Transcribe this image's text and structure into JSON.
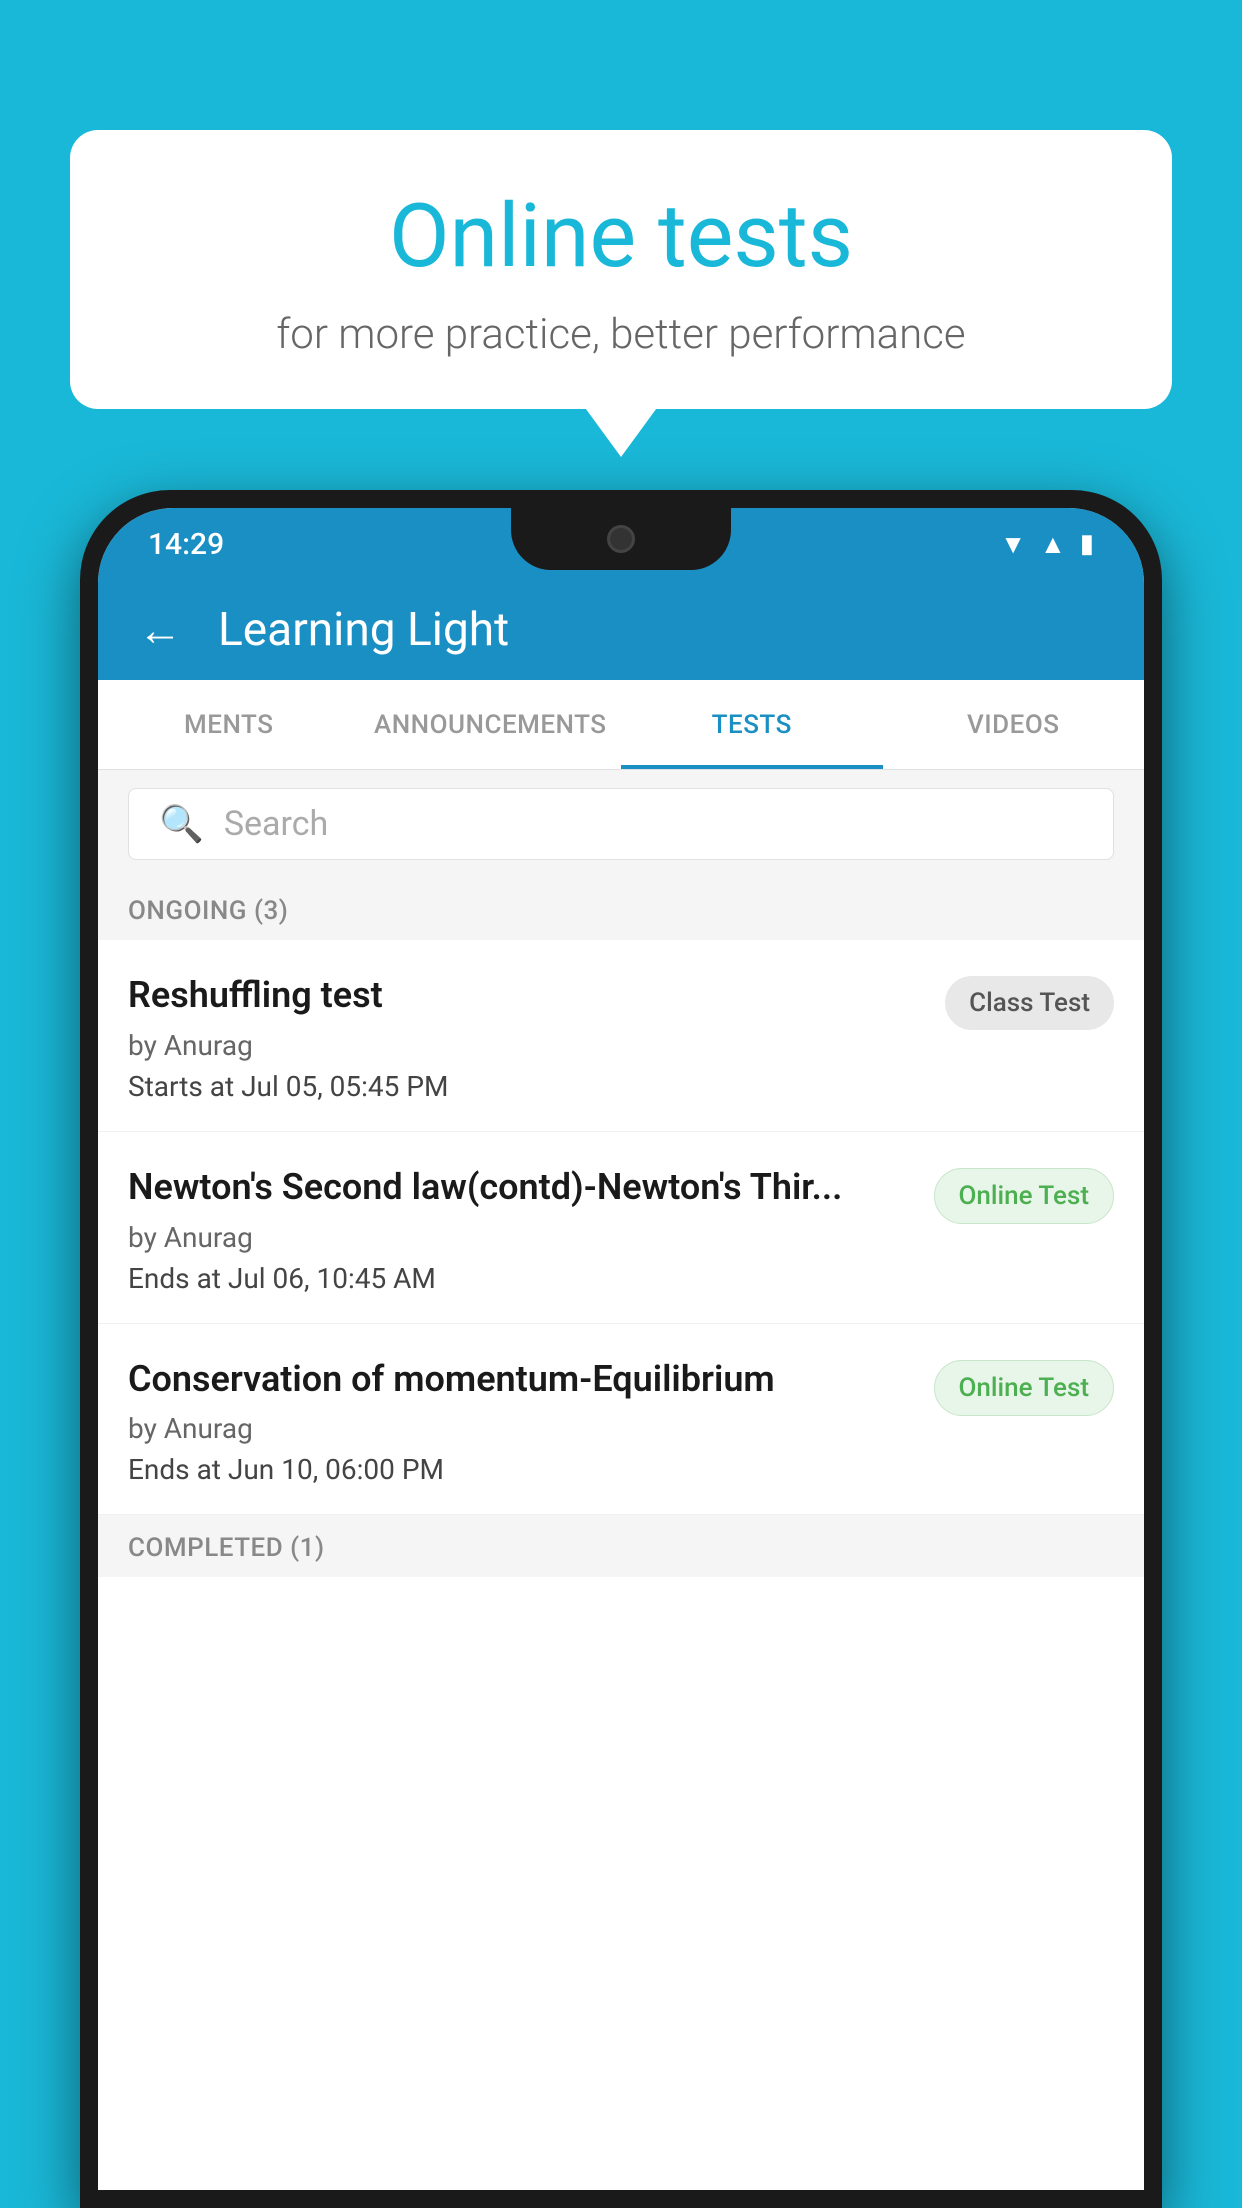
{
  "background": {
    "color": "#1ab8d8"
  },
  "speech_bubble": {
    "title": "Online tests",
    "subtitle": "for more practice, better performance"
  },
  "status_bar": {
    "time": "14:29",
    "icons": [
      "wifi",
      "signal",
      "battery"
    ]
  },
  "app_header": {
    "title": "Learning Light",
    "back_label": "←"
  },
  "tabs": [
    {
      "label": "MENTS",
      "active": false
    },
    {
      "label": "ANNOUNCEMENTS",
      "active": false
    },
    {
      "label": "TESTS",
      "active": true
    },
    {
      "label": "VIDEOS",
      "active": false
    }
  ],
  "search": {
    "placeholder": "Search"
  },
  "section_ongoing": {
    "label": "ONGOING (3)"
  },
  "tests": [
    {
      "name": "Reshuffling test",
      "author": "by Anurag",
      "time_label": "Starts at",
      "time_value": "Jul 05, 05:45 PM",
      "badge": "Class Test",
      "badge_type": "class"
    },
    {
      "name": "Newton's Second law(contd)-Newton's Thir...",
      "author": "by Anurag",
      "time_label": "Ends at",
      "time_value": "Jul 06, 10:45 AM",
      "badge": "Online Test",
      "badge_type": "online"
    },
    {
      "name": "Conservation of momentum-Equilibrium",
      "author": "by Anurag",
      "time_label": "Ends at",
      "time_value": "Jun 10, 06:00 PM",
      "badge": "Online Test",
      "badge_type": "online"
    }
  ],
  "section_completed": {
    "label": "COMPLETED (1)"
  }
}
